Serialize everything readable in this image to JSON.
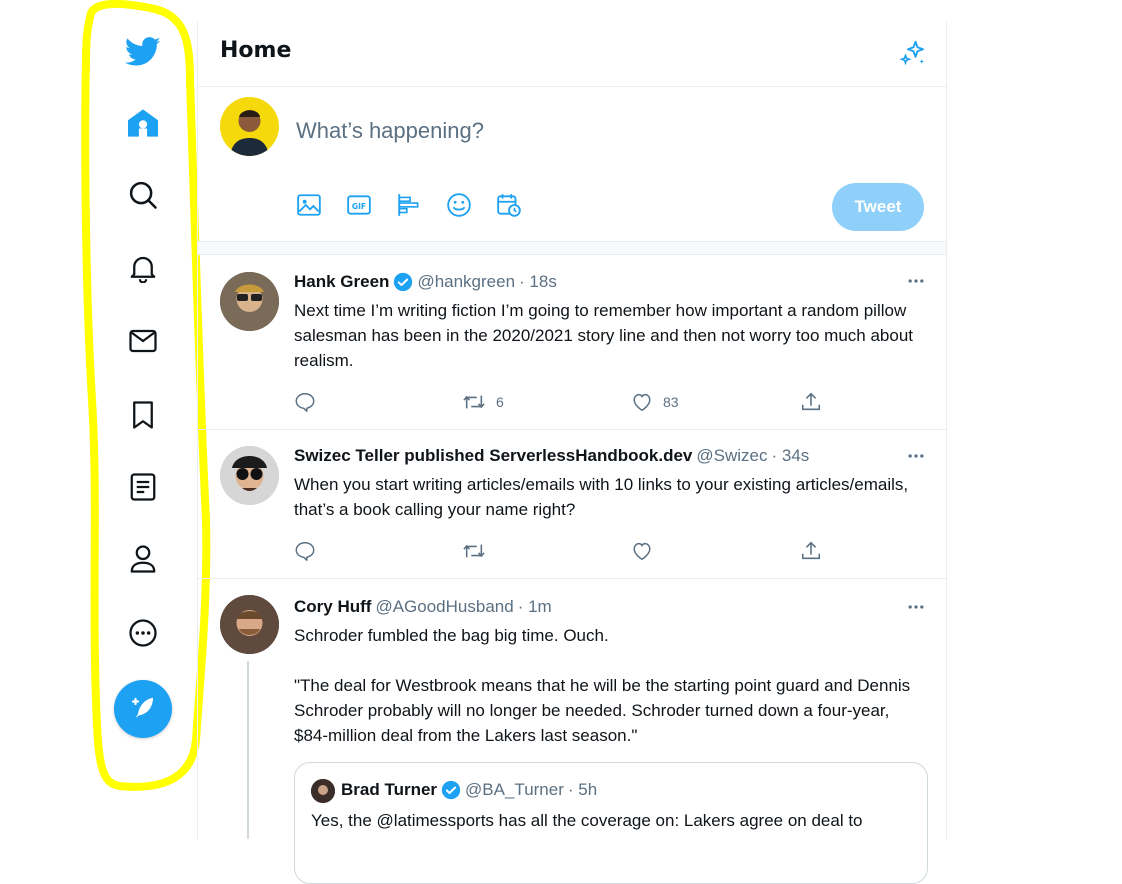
{
  "header": {
    "title": "Home"
  },
  "composer": {
    "placeholder": "What’s happening?",
    "tweet_label": "Tweet"
  },
  "tweets": [
    {
      "author": "Hank Green",
      "handle": "@hankgreen",
      "time": "· 18s",
      "verified": true,
      "text": "Next time I’m writing fiction I’m going to remember how important a random pillow salesman has been in the 2020/2021 story line and then not worry too much about realism.",
      "reply_count": "",
      "retweet_count": "6",
      "like_count": "83"
    },
    {
      "author": "Swizec Teller published ServerlessHandbook.dev",
      "handle": "@Swizec",
      "time": "· 34s",
      "verified": false,
      "text": "When you start writing articles/emails with 10 links to your existing articles/emails, that’s a book calling your name right?",
      "reply_count": "",
      "retweet_count": "",
      "like_count": ""
    },
    {
      "author": "Cory Huff",
      "handle": "@AGoodHusband",
      "time": "· 1m",
      "verified": false,
      "text": "Schroder fumbled the bag big time. Ouch.\n\n\"The deal for Westbrook means that he will be the starting point guard and Dennis Schroder probably will no longer be needed. Schroder turned down a four-year, $84-million deal from the Lakers last season.\""
    }
  ],
  "quote": {
    "author": "Brad Turner",
    "handle": "@BA_Turner",
    "time": "· 5h",
    "verified": true,
    "text": "Yes, the @latimessports has all the coverage on: Lakers agree on deal to"
  },
  "colors": {
    "accent": "#1da1f2",
    "accent_disabled": "#8ed0f9",
    "highlight": "#ffff00",
    "muted": "#5b7083"
  },
  "icons": [
    "twitter-logo-icon",
    "home-icon",
    "explore-icon",
    "notifications-icon",
    "messages-icon",
    "bookmarks-icon",
    "lists-icon",
    "profile-icon",
    "more-icon",
    "compose-icon"
  ]
}
